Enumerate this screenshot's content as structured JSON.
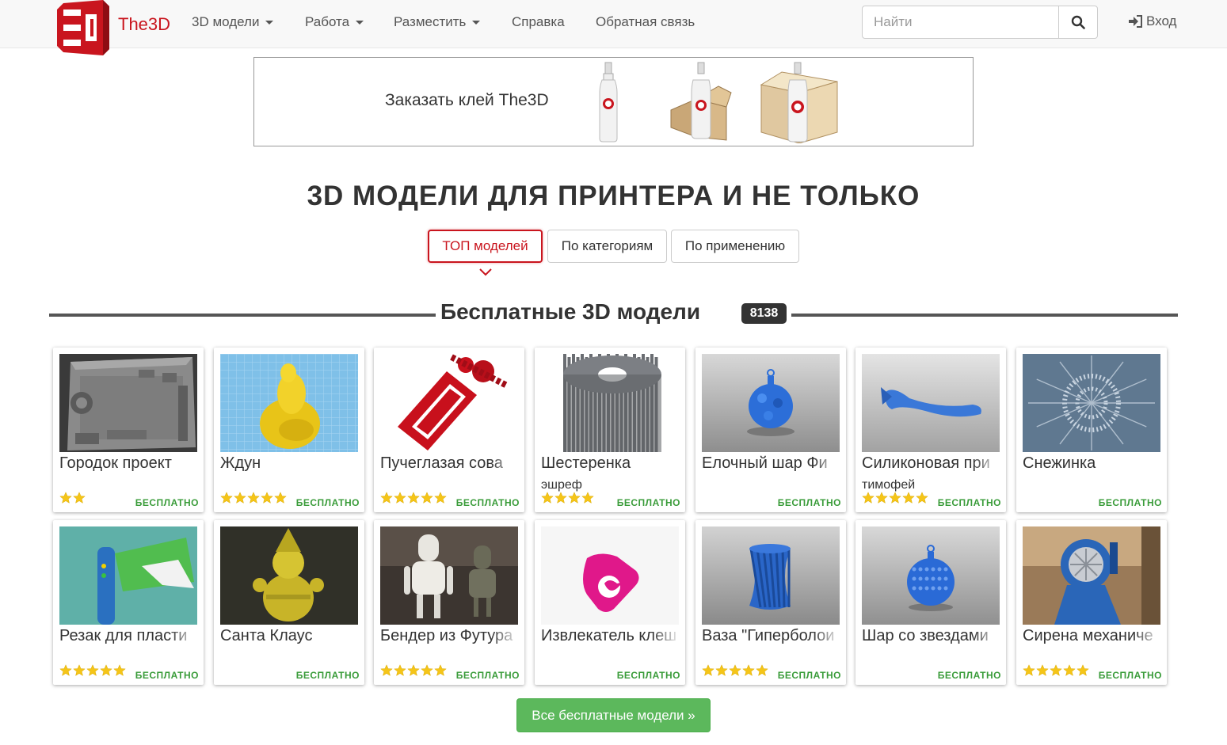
{
  "navbar": {
    "brand": "The3D",
    "menu": [
      {
        "label": "3D модели",
        "dropdown": true
      },
      {
        "label": "Работа",
        "dropdown": true
      },
      {
        "label": "Разместить",
        "dropdown": true
      },
      {
        "label": "Справка",
        "dropdown": false
      },
      {
        "label": "Обратная связь",
        "dropdown": false
      }
    ],
    "search_placeholder": "Найти",
    "login_label": "Вход"
  },
  "banner": {
    "text": "Заказать клей The3D"
  },
  "main_title": "3D МОДЕЛИ ДЛЯ ПРИНТЕРА И НЕ ТОЛЬКО",
  "tabs": [
    {
      "label": "ТОП моделей",
      "active": true
    },
    {
      "label": "По категориям",
      "active": false
    },
    {
      "label": "По применению",
      "active": false
    }
  ],
  "section": {
    "title": "Бесплатные 3D модели",
    "count": "8138"
  },
  "cards": [
    {
      "title": "Городок проект",
      "author": "",
      "rating": 2,
      "price": "БЕСПЛАТНО",
      "thumb": "town"
    },
    {
      "title": "Ждун",
      "author": "",
      "rating": 5,
      "price": "БЕСПЛАТНО",
      "thumb": "zhdun"
    },
    {
      "title": "Пучеглазая сова",
      "author": "",
      "rating": 5,
      "price": "БЕСПЛАТНО",
      "thumb": "owl"
    },
    {
      "title": "Шестеренка",
      "author": "эшреф",
      "rating": 4,
      "price": "БЕСПЛАТНО",
      "thumb": "gear"
    },
    {
      "title": "Елочный шар Фи",
      "author": "",
      "rating": 0,
      "price": "БЕСПЛАТНО",
      "thumb": "ballspiky"
    },
    {
      "title": "Силиконовая при",
      "author": "тимофей",
      "rating": 5,
      "price": "БЕСПЛАТНО",
      "thumb": "lure"
    },
    {
      "title": "Снежинка",
      "author": "",
      "rating": 0,
      "price": "БЕСПЛАТНО",
      "thumb": "snowflake"
    },
    {
      "title": "Резак для пласти",
      "author": "",
      "rating": 5,
      "price": "БЕСПЛАТНО",
      "thumb": "cutter"
    },
    {
      "title": "Санта Клаус",
      "author": "",
      "rating": 0,
      "price": "БЕСПЛАТНО",
      "thumb": "santa"
    },
    {
      "title": "Бендер из Футура",
      "author": "",
      "rating": 5,
      "price": "БЕСПЛАТНО",
      "thumb": "bender"
    },
    {
      "title": "Извлекатель клеш",
      "author": "",
      "rating": 0,
      "price": "БЕСПЛАТНО",
      "thumb": "extractor"
    },
    {
      "title": "Ваза \"Гиперболои",
      "author": "",
      "rating": 5,
      "price": "БЕСПЛАТНО",
      "thumb": "vase"
    },
    {
      "title": "Шар со звездами",
      "author": "",
      "rating": 0,
      "price": "БЕСПЛАТНО",
      "thumb": "ballstars"
    },
    {
      "title": "Сирена механиче",
      "author": "",
      "rating": 5,
      "price": "БЕСПЛАТНО",
      "thumb": "siren"
    }
  ],
  "all_button": "Все бесплатные модели »",
  "colors": {
    "brand_red": "#c9151e",
    "price_green": "#3a9c3a",
    "button_green": "#5cb85c",
    "star_gold": "#f5c518"
  }
}
